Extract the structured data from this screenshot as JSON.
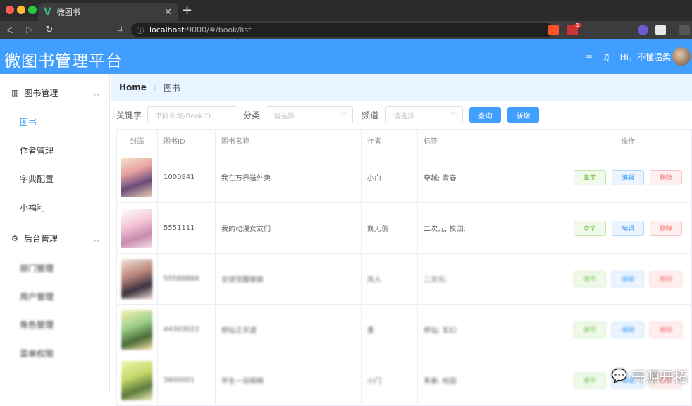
{
  "browser": {
    "tab_title": "微图书",
    "tab_logo": "V",
    "url_host": "localhost",
    "url_path": ":9000/#/book/list",
    "badge_count": "1"
  },
  "app": {
    "title": "微图书管理平台",
    "greeting": "Hi，不懂温柔",
    "brand_color": "#409eff"
  },
  "sidebar": {
    "group1": {
      "label": "图书管理",
      "icon": "chart-icon"
    },
    "group1_items": [
      {
        "label": "图书",
        "active": true
      },
      {
        "label": "作者管理"
      },
      {
        "label": "字典配置"
      },
      {
        "label": "小福利"
      }
    ],
    "group2": {
      "label": "后台管理",
      "icon": "gear-icon"
    },
    "group2_items": [
      {
        "label": "部门管理"
      },
      {
        "label": "用户管理"
      },
      {
        "label": "角色管理"
      },
      {
        "label": "菜单权限"
      }
    ]
  },
  "breadcrumb": {
    "home": "Home",
    "current": "图书"
  },
  "filters": {
    "keyword_label": "关键字",
    "keyword_placeholder": "书籍名称/BookID",
    "category_label": "分类",
    "category_placeholder": "请选择",
    "channel_label": "频道",
    "channel_placeholder": "请选择",
    "query_button": "查询",
    "add_button": "新增"
  },
  "table": {
    "headers": [
      "封面",
      "图书ID",
      "图书名称",
      "作者",
      "标签",
      "操作"
    ],
    "rows": [
      {
        "id": "1000941",
        "name": "我在万界送外卖",
        "author": "小白",
        "tags": "穿越; 青春"
      },
      {
        "id": "5551111",
        "name": "我的动漫女友们",
        "author": "魏无羡",
        "tags": "二次元; 校园;"
      },
      {
        "id": "55588866",
        "name": "全球觉醒御兽",
        "author": "风人",
        "tags": "二次元;",
        "blurred": true
      },
      {
        "id": "44303022",
        "name": "修仙之天道",
        "author": "墨",
        "tags": "修仙; 玄幻",
        "blurred": true
      },
      {
        "id": "3800001",
        "name": "学生一双眼睛",
        "author": "小门",
        "tags": "青春; 校园",
        "blurred": true
      }
    ],
    "op_chapter": "章节",
    "op_edit": "编辑",
    "op_delete": "删除"
  },
  "watermark": "开源开拓"
}
